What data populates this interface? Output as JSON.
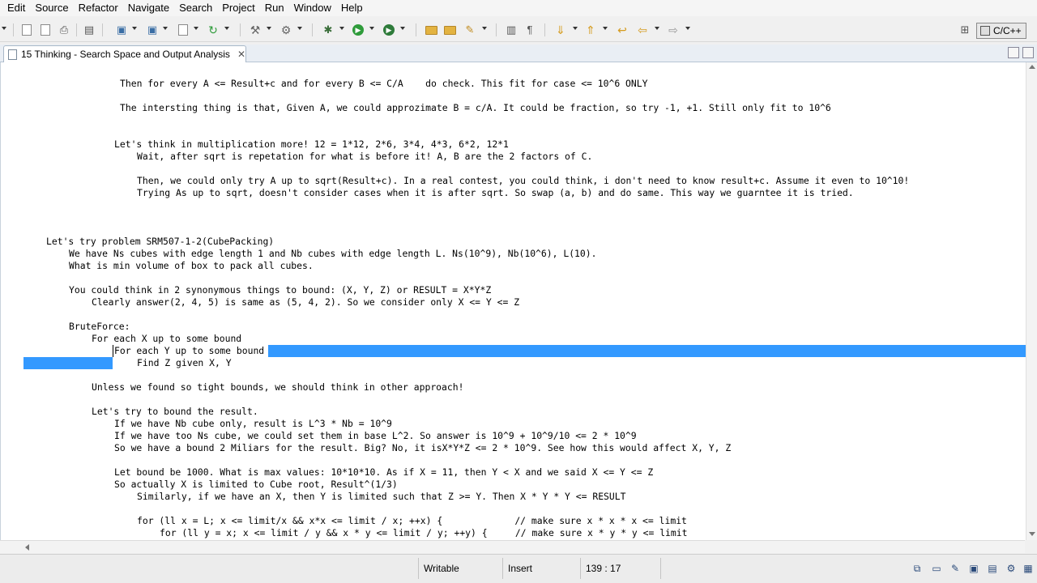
{
  "menu": [
    "Edit",
    "Source",
    "Refactor",
    "Navigate",
    "Search",
    "Project",
    "Run",
    "Window",
    "Help"
  ],
  "perspective": "C/C++",
  "tab": {
    "title": "15 Thinking - Search Space and Output Analysis",
    "close": "✕"
  },
  "editor": {
    "lines": [
      "Then for every A <= Result+c and for every B <= C/A    do check. This fit for case <= 10^6 ONLY",
      "The intersting thing is that, Given A, we could approzimate B = c/A. It could be fraction, so try -1, +1. Still only fit to 10^6",
      "Let's think in multiplication more! 12 = 1*12, 2*6, 3*4, 4*3, 6*2, 12*1",
      "Wait, after sqrt is repetation for what is before it! A, B are the 2 factors of C.",
      "Then, we could only try A up to sqrt(Result+c). In a real contest, you could think, i don't need to know result+c. Assume it even to 10^10!",
      "Trying As up to sqrt, doesn't consider cases when it is after sqrt. So swap (a, b) and do same. This way we guarntee it is tried.",
      "Let's try problem SRM507-1-2(CubePacking)",
      "We have Ns cubes with edge length 1 and Nb cubes with edge length L. Ns(10^9), Nb(10^6), L(10).",
      "What is min volume of box to pack all cubes.",
      "You could think in 2 synonymous things to bound: (X, Y, Z) or RESULT = X*Y*Z",
      "Clearly answer(2, 4, 5) is same as (5, 4, 2). So we consider only X <= Y <= Z",
      "BruteForce:",
      "For each X up to some bound",
      "For each Y up to some bound",
      "Find Z given X, Y",
      "Unless we found so tight bounds, we should think in other approach!",
      "Let's try to bound the result.",
      "If we have Nb cube only, result is L^3 * Nb = 10^9",
      "If we have too Ns cube, we could set them in base L^2. So answer is 10^9 + 10^9/10 <= 2 * 10^9",
      "So we have a bound 2 Miliars for the result. Big? No, it isX*Y*Z <= 2 * 10^9. See how this would affect X, Y, Z",
      "Let bound be 1000. What is max values: 10*10*10. As if X = 11, then Y < X and we said X <= Y <= Z",
      "So actually X is limited to Cube root, Result^(1/3)",
      "Similarly, if we have an X, then Y is limited such that Z >= Y. Then X * Y * Y <= RESULT",
      "for (ll x = L; x <= limit/x && x*x <= limit / x; ++x) {             // make sure x * x * x <= limit",
      "for (ll y = x; x <= limit / y && x * y <= limit / y; ++y) {     // make sure x * y * y <= limit"
    ]
  },
  "status": {
    "writable": "Writable",
    "insert_mode": "Insert",
    "position": "139 : 17"
  },
  "colors": {
    "selection": "#3399ff",
    "editor_bg": "#ffffff",
    "chrome_bg": "#f0f0f0"
  }
}
